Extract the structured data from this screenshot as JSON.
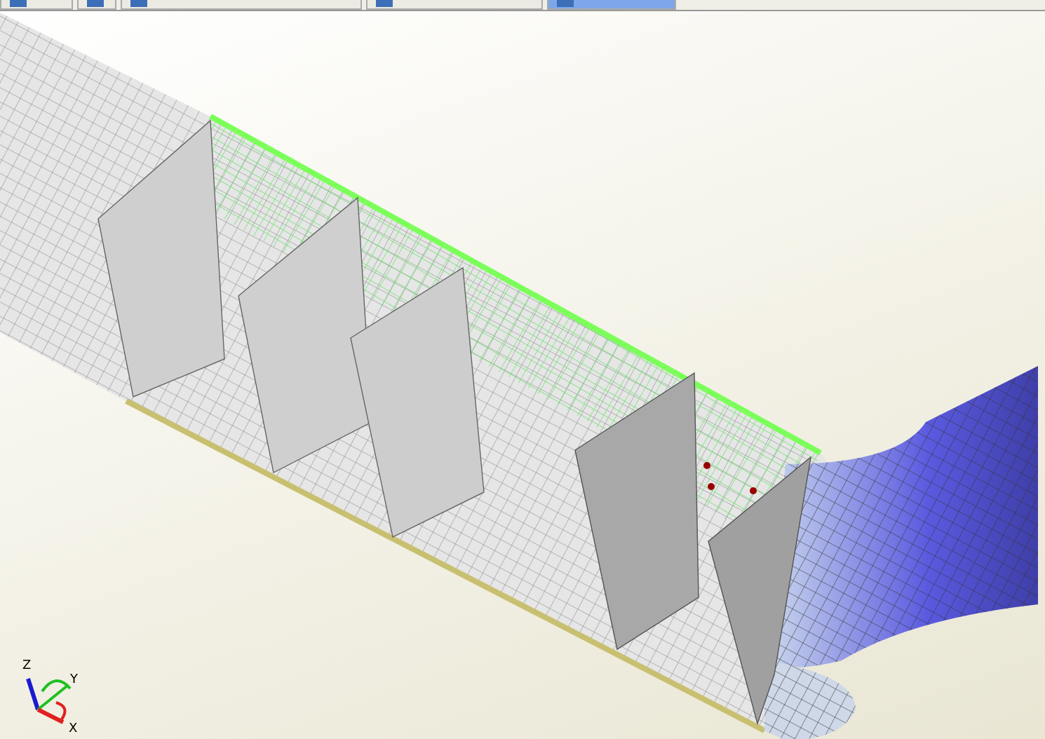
{
  "tabs": [
    {
      "selected": false
    },
    {
      "selected": false
    },
    {
      "selected": false
    },
    {
      "selected": false
    },
    {
      "selected": true
    }
  ],
  "axis_triad": {
    "labels": [
      "Z",
      "Y",
      "X"
    ]
  }
}
